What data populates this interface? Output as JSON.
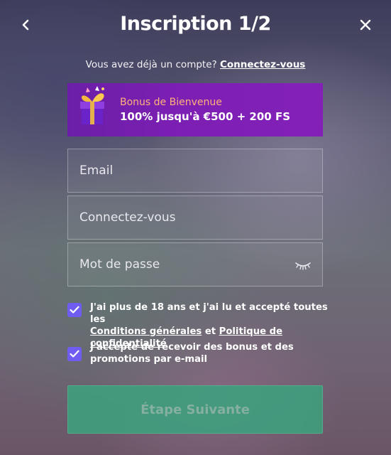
{
  "header": {
    "title": "Inscription 1/2",
    "back_icon": "chevron-left-icon",
    "close_icon": "close-icon"
  },
  "login_prompt": {
    "text": "Vous avez déjà un compte?",
    "link": "Connectez-vous"
  },
  "bonus": {
    "icon": "gift-icon",
    "subtitle": "Bonus de Bienvenue",
    "headline": "100% jusqu'à €500 + 200 FS"
  },
  "form": {
    "email_placeholder": "Email",
    "username_placeholder": "Connectez-vous",
    "password_placeholder": "Mot de passe",
    "password_toggle_icon": "eye-closed-icon"
  },
  "consents": {
    "age": {
      "checked": true,
      "text_before": "J'ai plus de 18 ans et j'ai lu et accepté toutes les",
      "terms_link": "Conditions générales",
      "conjunction": "et",
      "privacy_link": "Politique de confidentialité"
    },
    "marketing": {
      "checked": true,
      "text": "J'accepte de recevoir des bonus et des promotions par e-mail"
    }
  },
  "next_button": {
    "label": "Étape Suivante"
  },
  "colors": {
    "bonus_bg": "#7e1fb4",
    "bonus_subtitle": "#ffb27a",
    "checkbox": "#6f5cf0",
    "next_button": "#3f9f7e"
  }
}
